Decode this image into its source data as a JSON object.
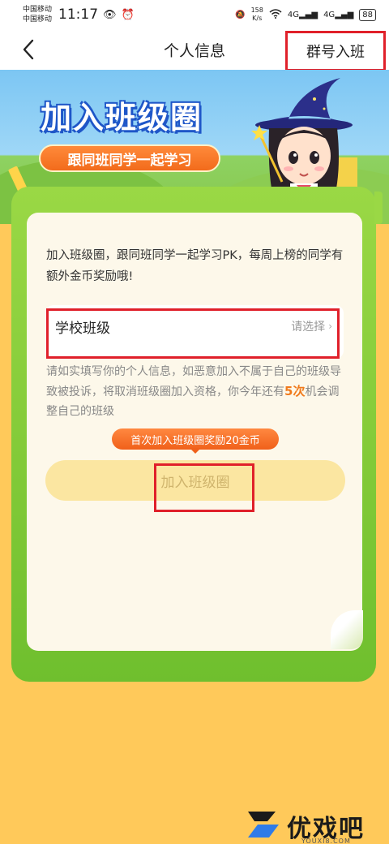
{
  "status_bar": {
    "carrier1": "中国移动",
    "carrier2": "中国移动",
    "time": "11:17",
    "speed_value": "158",
    "speed_unit": "K/s",
    "network1": "4G",
    "network2": "4G",
    "battery": "88"
  },
  "nav": {
    "back_icon": "chevron-left-icon",
    "title": "个人信息",
    "right_action": "群号入班"
  },
  "hero": {
    "title": "加入班级圈",
    "subtitle": "跟同班同学一起学习"
  },
  "card": {
    "intro": "加入班级圈，跟同班同学一起学习PK，每周上榜的同学有额外金币奖励哦!",
    "school_field": {
      "label": "学校班级",
      "value": "请选择",
      "chevron": "›"
    },
    "notice_before": "请如实填写你的个人信息，如恶意加入不属于自己的班级导致被投诉，将取消班级圈加入资格，你今年还有",
    "notice_count": "5",
    "notice_unit": "次",
    "notice_after": "机会调整自己的班级",
    "reward_badge": "首次加入班级圈奖励20金币",
    "join_button": "加入班级圈"
  },
  "watermark": {
    "text": "优戏吧",
    "url": "YOUXI8.COM"
  },
  "colors": {
    "highlight_red": "#e0202a",
    "accent_orange": "#f07a1c",
    "card_green": "#7cc243",
    "background": "#ffc95a"
  }
}
